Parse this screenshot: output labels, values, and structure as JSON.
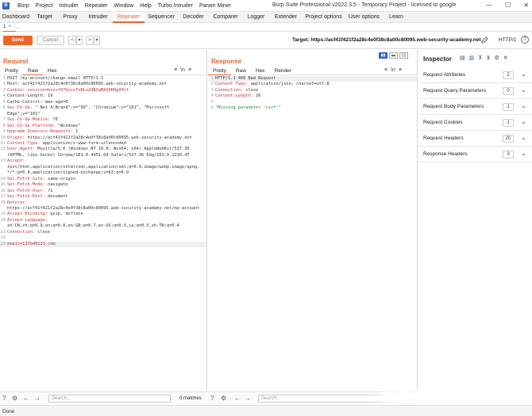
{
  "title_bar": {
    "logo": "B",
    "menus": [
      "Burp",
      "Project",
      "Intruder",
      "Repeater",
      "Window",
      "Help",
      "Turbo Intruder",
      "Param Miner"
    ],
    "app_title": "Burp Suite Professional v2022.3.5 - Temporary Project - licensed to google",
    "controls": [
      "—",
      "☐",
      "✕"
    ]
  },
  "main_tabs": [
    {
      "label": "Dashboard",
      "w": 40
    },
    {
      "label": "Target",
      "w": 32
    },
    {
      "label": "Proxy",
      "w": 33
    },
    {
      "label": "Intruder",
      "w": 37
    },
    {
      "label": "Repeater",
      "w": 40,
      "active": true
    },
    {
      "label": "Sequencer",
      "w": 42
    },
    {
      "label": "Decoder",
      "w": 39
    },
    {
      "label": "Comparer",
      "w": 42
    },
    {
      "label": "Logger",
      "w": 35
    },
    {
      "label": "Extender",
      "w": 40
    },
    {
      "label": "Project options",
      "w": 55
    },
    {
      "label": "User options",
      "w": 47
    },
    {
      "label": "Learn",
      "w": 34
    }
  ],
  "sub_tabs": {
    "tab1": "1",
    "tab1_close": "×",
    "add": "..."
  },
  "toolbar": {
    "send": "Send",
    "cancel": "Cancel",
    "back": "<",
    "back_menu": "▾",
    "forward": ">",
    "forward_menu": "▾",
    "target_label": "Target: ",
    "target_url": "https://acf41f421f2a28c4e0f38c8a00c80095.web-security-academy.net",
    "http_version": "HTTP/1",
    "help": "?"
  },
  "request": {
    "title": "Request",
    "tabs": [
      "Pretty",
      "Raw",
      "Hex"
    ],
    "active_tab": "Raw",
    "icons": [
      "≡",
      "\\n",
      "≡"
    ],
    "lines": [
      {
        "n": "1",
        "parts": [
          [
            "hv",
            "POST /my-account/change-email HTTP/1.1"
          ]
        ]
      },
      {
        "n": "2",
        "parts": [
          [
            "hv",
            "Host: acf41f421f2a28c4e0f38c8a00c80095.web-security-academy.net"
          ]
        ]
      },
      {
        "n": "3",
        "parts": [
          [
            "hk",
            "Cookie: "
          ],
          [
            "body",
            "session=bxzxfO7QsssToNLo2QNSqMAQ0HQgXHlf"
          ]
        ]
      },
      {
        "n": "4",
        "parts": [
          [
            "hv",
            "Content-Length: 19"
          ]
        ]
      },
      {
        "n": "5",
        "parts": [
          [
            "hv",
            "Cache-Control: max-age=0"
          ]
        ]
      },
      {
        "n": "6",
        "parts": [
          [
            "hk",
            "Sec-Ch-Ua: "
          ],
          [
            "hv",
            "\" Not A;Brand\";v=\"99\", \"Chromium\";v=\"101\", \"Microsoft"
          ]
        ]
      },
      {
        "n": "",
        "wrap": true,
        "parts": [
          [
            "hv",
            "Edge\";v=\"101\""
          ]
        ]
      },
      {
        "n": "7",
        "parts": [
          [
            "hk",
            "Sec-Ch-Ua-Mobile: "
          ],
          [
            "hv",
            "?0"
          ]
        ]
      },
      {
        "n": "8",
        "parts": [
          [
            "hk",
            "Sec-Ch-Ua-Platform: "
          ],
          [
            "hv",
            "\"Windows\""
          ]
        ]
      },
      {
        "n": "9",
        "parts": [
          [
            "hk",
            "Upgrade-Insecure-Requests: "
          ],
          [
            "hv",
            "1"
          ]
        ]
      },
      {
        "n": "10",
        "parts": [
          [
            "hk",
            "Origin: "
          ],
          [
            "hv",
            "https://acf41f421f2a28c4e0f38c8a00c80095.web-security-academy.net"
          ]
        ]
      },
      {
        "n": "11",
        "parts": [
          [
            "hk",
            "Content-Type: "
          ],
          [
            "hv",
            "application/x-www-form-urlencoded"
          ]
        ]
      },
      {
        "n": "12",
        "parts": [
          [
            "hk",
            "User-Agent: "
          ],
          [
            "hv",
            "Mozilla/5.0 (Windows NT 10.0; Win64; x64) AppleWebKit/537.36"
          ]
        ]
      },
      {
        "n": "",
        "wrap": true,
        "parts": [
          [
            "hv",
            "(KHTML, like Gecko) Chrome/101.0.4951.64 Safari/537.36 Edg/101.0.1210.47"
          ]
        ]
      },
      {
        "n": "13",
        "parts": [
          [
            "hk",
            "Accept:"
          ]
        ]
      },
      {
        "n": "",
        "wrap": true,
        "parts": [
          [
            "hv",
            "text/html,application/xhtml+xml,application/xml;q=0.9,image/webp,image/apng,"
          ]
        ]
      },
      {
        "n": "",
        "wrap": true,
        "parts": [
          [
            "hv",
            "*/*;q=0.8,application/signed-exchange;v=b3;q=0.9"
          ]
        ]
      },
      {
        "n": "14",
        "parts": [
          [
            "hk",
            "Sec-Fetch-Site: "
          ],
          [
            "hv",
            "same-origin"
          ]
        ]
      },
      {
        "n": "15",
        "parts": [
          [
            "hk",
            "Sec-Fetch-Mode: "
          ],
          [
            "hv",
            "navigate"
          ]
        ]
      },
      {
        "n": "16",
        "parts": [
          [
            "hk",
            "Sec-Fetch-User: "
          ],
          [
            "hv",
            "?1"
          ]
        ]
      },
      {
        "n": "17",
        "parts": [
          [
            "hk",
            "Sec-Fetch-Dest: "
          ],
          [
            "hv",
            "document"
          ]
        ]
      },
      {
        "n": "18",
        "parts": [
          [
            "hk",
            "Referer:"
          ]
        ]
      },
      {
        "n": "",
        "wrap": true,
        "parts": [
          [
            "hv",
            "https://acf41f421f2a28c4e0f38c8a00c80095.web-security-academy.net/my-account"
          ]
        ]
      },
      {
        "n": "19",
        "parts": [
          [
            "hk",
            "Accept-Encoding: "
          ],
          [
            "hv",
            "gzip, deflate"
          ]
        ]
      },
      {
        "n": "20",
        "parts": [
          [
            "hk",
            "Accept-Language:"
          ]
        ]
      },
      {
        "n": "",
        "wrap": true,
        "parts": [
          [
            "hv",
            "zh-CN,zh;q=0.9,en;q=0.8,en-GB;q=0.7,en-US;q=0.6,ja;q=0.5,zh-TW;q=0.4"
          ]
        ]
      },
      {
        "n": "21",
        "parts": [
          [
            "hk",
            "Connection: "
          ],
          [
            "hv",
            "close"
          ]
        ]
      },
      {
        "n": "22",
        "parts": [
          [
            "hv",
            ""
          ]
        ]
      },
      {
        "n": "23",
        "hl": true,
        "parts": [
          [
            "body",
            "email=123%40123.com"
          ]
        ]
      }
    ]
  },
  "response": {
    "title": "Response",
    "tabs": [
      "Pretty",
      "Raw",
      "Hex",
      "Render"
    ],
    "active_tab": "Pretty",
    "icons": [
      "≡",
      "\\n",
      "≡"
    ],
    "lines": [
      {
        "n": "1",
        "hl": true,
        "parts": [
          [
            "hv",
            "HTTP/1.1 400 Bad Request"
          ]
        ]
      },
      {
        "n": "2",
        "parts": [
          [
            "hk",
            "Content-Type: "
          ],
          [
            "hv",
            "application/json; charset=utf-8"
          ]
        ]
      },
      {
        "n": "3",
        "parts": [
          [
            "hk",
            "Connection: "
          ],
          [
            "hv",
            "close"
          ]
        ]
      },
      {
        "n": "4",
        "parts": [
          [
            "hk",
            "Content-Length: "
          ],
          [
            "hv",
            "26"
          ]
        ]
      },
      {
        "n": "5",
        "parts": [
          [
            "hv",
            ""
          ]
        ]
      },
      {
        "n": "6",
        "parts": [
          [
            "str",
            "\"Missing parameter 'csrf'\""
          ]
        ]
      }
    ]
  },
  "layout_icons": [
    "▮▮",
    "▬",
    "▯▯"
  ],
  "inspector": {
    "title": "Inspector",
    "icons": [
      "▤",
      "▥",
      "⊼",
      "⊻",
      "⚙",
      "✕"
    ],
    "sections": [
      {
        "label": "Request Attributes",
        "count": "2"
      },
      {
        "label": "Request Query Parameters",
        "count": "0"
      },
      {
        "label": "Request Body Parameters",
        "count": "1"
      },
      {
        "label": "Request Cookies",
        "count": "1"
      },
      {
        "label": "Request Headers",
        "count": "20"
      },
      {
        "label": "Response Headers",
        "count": "3"
      }
    ],
    "chevron": "⌄"
  },
  "request_search": {
    "placeholder": "Search...",
    "matches": "0 matches",
    "icons": [
      "?",
      "⚙",
      "←",
      "→"
    ]
  },
  "response_search": {
    "placeholder": "Search...",
    "icons": [
      "?",
      "⚙",
      "←",
      "→"
    ]
  },
  "status": {
    "text": "Done"
  }
}
